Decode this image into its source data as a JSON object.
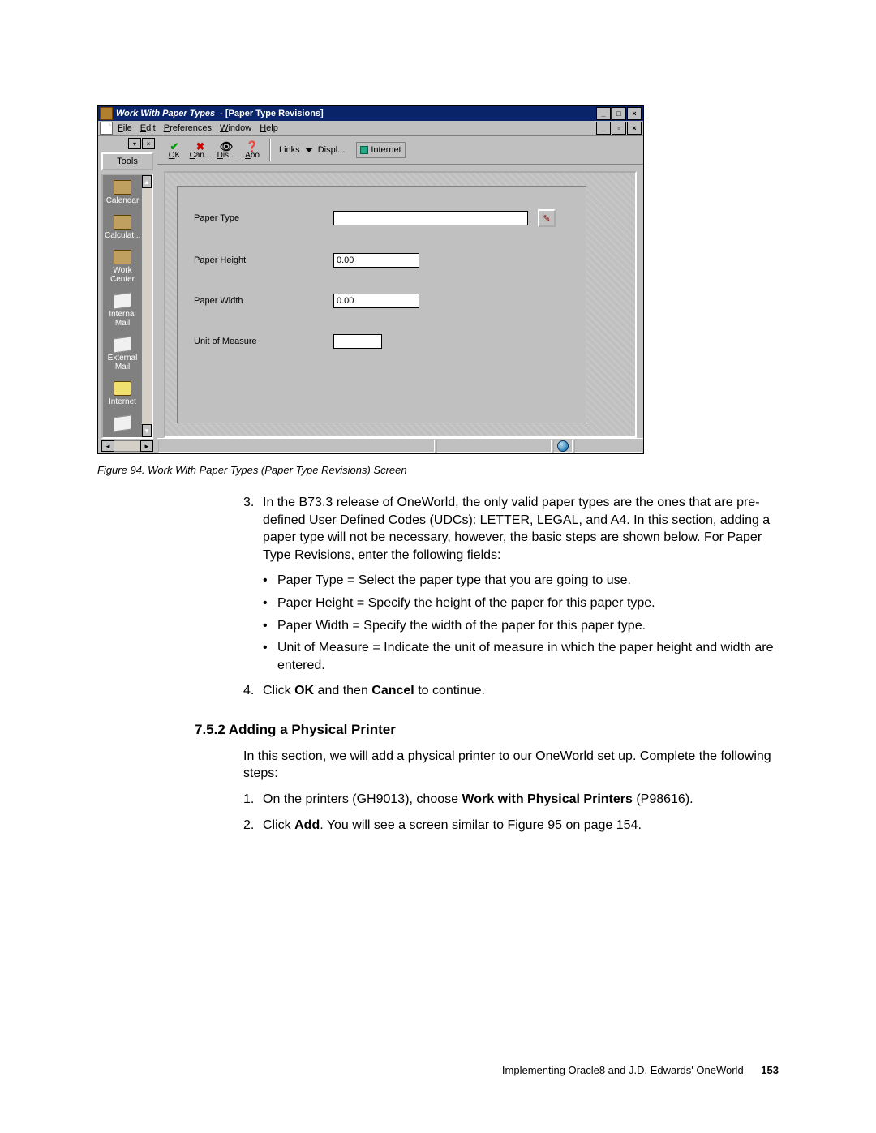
{
  "window": {
    "title_main": "Work With Paper Types",
    "title_sub": "- [Paper Type Revisions]"
  },
  "menu": {
    "file": "File",
    "edit": "Edit",
    "preferences": "Preferences",
    "window": "Window",
    "help": "Help"
  },
  "sidebar": {
    "tools": "Tools",
    "items": [
      {
        "label": "Calendar"
      },
      {
        "label": "Calculat..."
      },
      {
        "label": "Work Center"
      },
      {
        "label": "Internal Mail"
      },
      {
        "label": "External Mail"
      },
      {
        "label": "Internet"
      }
    ]
  },
  "toolbar": {
    "ok": {
      "label": "OK"
    },
    "can": {
      "label": "Can..."
    },
    "dis": {
      "label": "Dis..."
    },
    "abo": {
      "label": "Abo..."
    },
    "links": "Links",
    "displ": "Displ...",
    "internet": "Internet"
  },
  "form": {
    "paper_type": {
      "label": "Paper Type",
      "value": ""
    },
    "paper_height": {
      "label": "Paper Height",
      "value": "0.00"
    },
    "paper_width": {
      "label": "Paper Width",
      "value": "0.00"
    },
    "unit": {
      "label": "Unit of Measure",
      "value": ""
    }
  },
  "caption": "Figure 94. Work With Paper Types (Paper Type Revisions) Screen",
  "text": {
    "item3": "In the B73.3 release of OneWorld, the only valid paper types are the ones that are pre-defined User Defined Codes (UDCs): LETTER, LEGAL, and A4. In this section, adding a paper type will not be necessary, however, the basic steps are shown below. For Paper Type Revisions, enter the following fields:",
    "b1": "Paper Type = Select the paper type that you are going to use.",
    "b2": "Paper Height = Specify the height of the paper for this paper type.",
    "b3": "Paper Width = Specify the width of the paper for this paper type.",
    "b4": "Unit of Measure = Indicate the unit of measure in which the paper height and width are entered.",
    "item4_a": "Click ",
    "item4_b": "OK",
    "item4_c": " and then ",
    "item4_d": "Cancel",
    "item4_e": " to continue.",
    "sec_head": "7.5.2  Adding a Physical Printer",
    "sec_p": "In this section, we will add a physical printer to our OneWorld set up. Complete the following steps:",
    "s1_a": "On the printers (GH9013), choose ",
    "s1_b": "Work with Physical Printers",
    "s1_c": " (P98616).",
    "s2_a": "Click ",
    "s2_b": "Add",
    "s2_c": ". You will see a screen similar to Figure 95 on page 154."
  },
  "footer": {
    "text": "Implementing Oracle8 and J.D. Edwards' OneWorld",
    "page": "153"
  }
}
